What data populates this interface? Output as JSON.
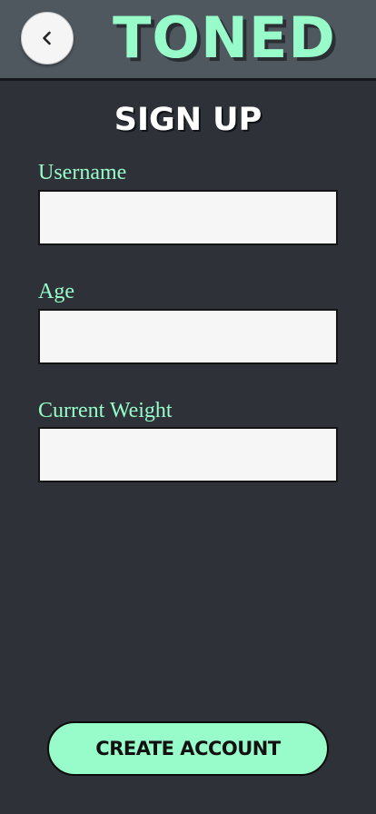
{
  "header": {
    "back_icon": "chevron-left-icon",
    "brand": "TONED"
  },
  "page": {
    "title": "SIGN UP"
  },
  "form": {
    "fields": [
      {
        "label": "Username",
        "value": "",
        "placeholder": ""
      },
      {
        "label": "Age",
        "value": "",
        "placeholder": ""
      },
      {
        "label": "Current Weight",
        "value": "",
        "placeholder": ""
      }
    ],
    "submit_label": "CREATE ACCOUNT"
  },
  "colors": {
    "background": "#2e3238",
    "header": "#4f585f",
    "accent": "#97fcc9",
    "input_bg": "#f6f6f6"
  }
}
